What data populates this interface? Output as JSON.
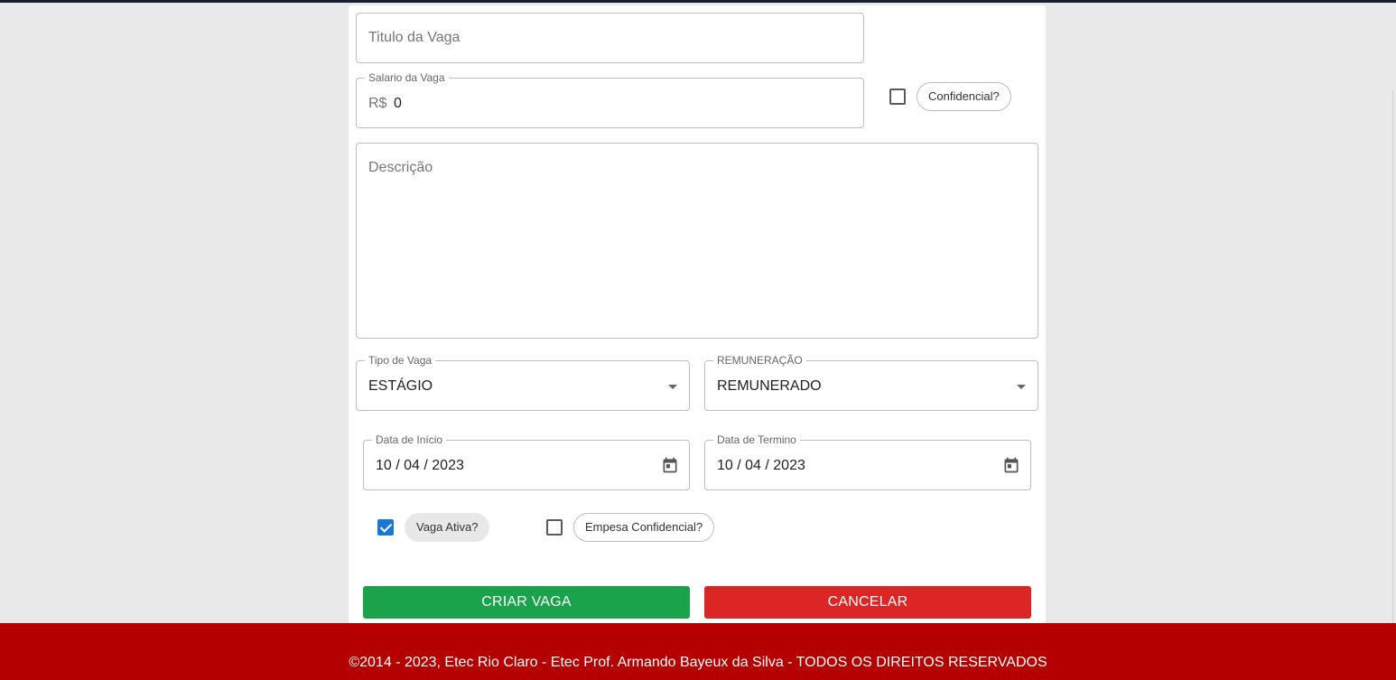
{
  "form": {
    "title_placeholder": "Titulo da Vaga",
    "salary": {
      "label": "Salario da Vaga",
      "prefix": "R$",
      "value": "0"
    },
    "confidential_chip": "Confidencial?",
    "description_placeholder": "Descrição",
    "job_type": {
      "label": "Tipo de Vaga",
      "value": "ESTÁGIO"
    },
    "remuneration": {
      "label": "REMUNERAÇÃO",
      "value": "REMUNERADO"
    },
    "start_date": {
      "label": "Data de Início",
      "value": "10 / 04 / 2023"
    },
    "end_date": {
      "label": "Data de Termino",
      "value": "10 / 04 / 2023"
    },
    "active_chip": "Vaga Ativa?",
    "company_confidential_chip": "Empesa Confidencial?",
    "create_button": "CRIAR VAGA",
    "cancel_button": "CANCELAR"
  },
  "checkboxes": {
    "confidential": false,
    "active": true,
    "company_confidential": false
  },
  "footer": {
    "text": "©2014 - 2023, Etec Rio Claro - Etec Prof. Armando Bayeux da Silva - TODOS OS DIREITOS RESERVADOS"
  },
  "colors": {
    "primary": "#1976d2",
    "create": "#1aa34a",
    "cancel": "#dc2626",
    "footer": "#b40000"
  },
  "icons": {
    "date": "calendar-icon",
    "select": "chevron-down-icon"
  }
}
